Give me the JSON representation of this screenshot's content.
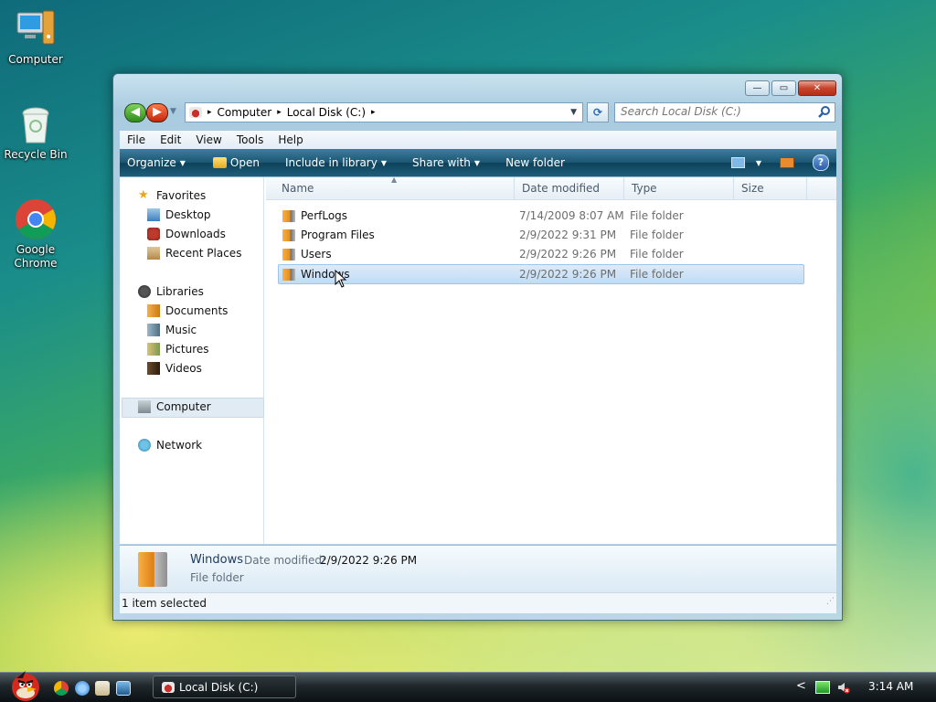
{
  "desktop": {
    "icons": [
      {
        "label": "Computer",
        "icon": "computer-icon"
      },
      {
        "label": "Recycle Bin",
        "icon": "recycle-bin-icon"
      },
      {
        "label": "Google Chrome",
        "icon": "chrome-icon"
      }
    ]
  },
  "window": {
    "controls": {
      "minimize": "—",
      "maximize": "▭",
      "close": "✕"
    },
    "address": {
      "crumbs": [
        "Computer",
        "Local Disk (C:)"
      ],
      "separator": "▸"
    },
    "search": {
      "placeholder": "Search Local Disk (C:)"
    },
    "menu": [
      "File",
      "Edit",
      "View",
      "Tools",
      "Help"
    ],
    "toolbar": {
      "organize": "Organize",
      "open": "Open",
      "include": "Include in library",
      "share": "Share with",
      "new_folder": "New folder",
      "help": "?"
    },
    "nav": {
      "favorites": "Favorites",
      "desktop": "Desktop",
      "downloads": "Downloads",
      "recent": "Recent Places",
      "libraries": "Libraries",
      "documents": "Documents",
      "music": "Music",
      "pictures": "Pictures",
      "videos": "Videos",
      "computer": "Computer",
      "network": "Network"
    },
    "columns": {
      "name": "Name",
      "date": "Date modified",
      "type": "Type",
      "size": "Size"
    },
    "files": [
      {
        "name": "PerfLogs",
        "date": "7/14/2009 8:07 AM",
        "type": "File folder"
      },
      {
        "name": "Program Files",
        "date": "2/9/2022 9:31 PM",
        "type": "File folder"
      },
      {
        "name": "Users",
        "date": "2/9/2022 9:26 PM",
        "type": "File folder"
      },
      {
        "name": "Windows",
        "date": "2/9/2022 9:26 PM",
        "type": "File folder"
      }
    ],
    "selected_index": 3,
    "details": {
      "name": "Windows",
      "date_label": "Date modified:",
      "date_value": "2/9/2022 9:26 PM",
      "type": "File folder"
    },
    "status": "1 item selected"
  },
  "taskbar": {
    "task_label": "Local Disk (C:)",
    "clock": "3:14 AM",
    "tray_arrow": "<"
  }
}
